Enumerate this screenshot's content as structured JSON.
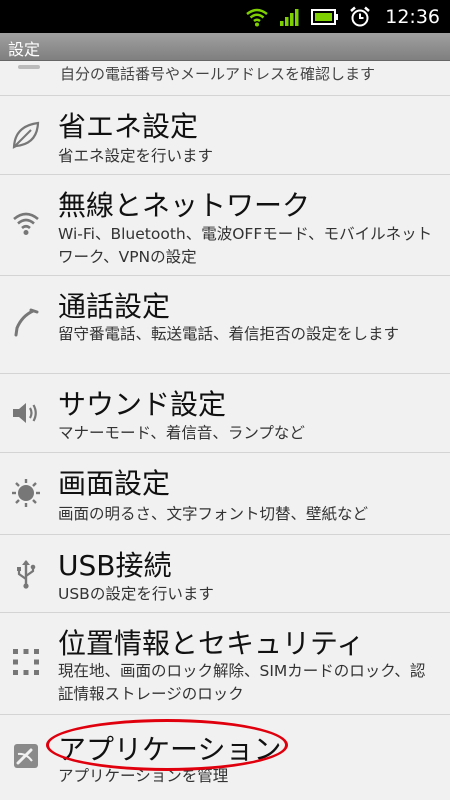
{
  "status_bar": {
    "time": "12:36",
    "icons": [
      "wifi-icon",
      "signal-icon",
      "battery-icon",
      "alarm-icon"
    ],
    "accent": "#7fd000"
  },
  "title_bar": {
    "title": "設定"
  },
  "list": {
    "partial_item": {
      "description": "自分の電話番号やメールアドレスを確認します"
    },
    "items": [
      {
        "icon": "leaf-icon",
        "title": "省エネ設定",
        "description": "省エネ設定を行います"
      },
      {
        "icon": "wifi-icon",
        "title": "無線とネットワーク",
        "description": "Wi-Fi、Bluetooth、電波OFFモード、モバイルネットワーク、VPNの設定"
      },
      {
        "icon": "phone-icon",
        "title": "通話設定",
        "description": "留守番電話、転送電話、着信拒否の設定をします"
      },
      {
        "icon": "speaker-icon",
        "title": "サウンド設定",
        "description": "マナーモード、着信音、ランプなど"
      },
      {
        "icon": "brightness-icon",
        "title": "画面設定",
        "description": "画面の明るさ、文字フォント切替、壁紙など"
      },
      {
        "icon": "usb-icon",
        "title": "USB接続",
        "description": "USBの設定を行います"
      },
      {
        "icon": "lock-pattern-icon",
        "title": "位置情報とセキュリティ",
        "description": "現在地、画面のロック解除、SIMカードのロック、認証情報ストレージのロック"
      },
      {
        "icon": "application-icon",
        "title": "アプリケーション",
        "description": "アプリケーションを管理"
      }
    ]
  },
  "annotation_color": "#e0000d"
}
